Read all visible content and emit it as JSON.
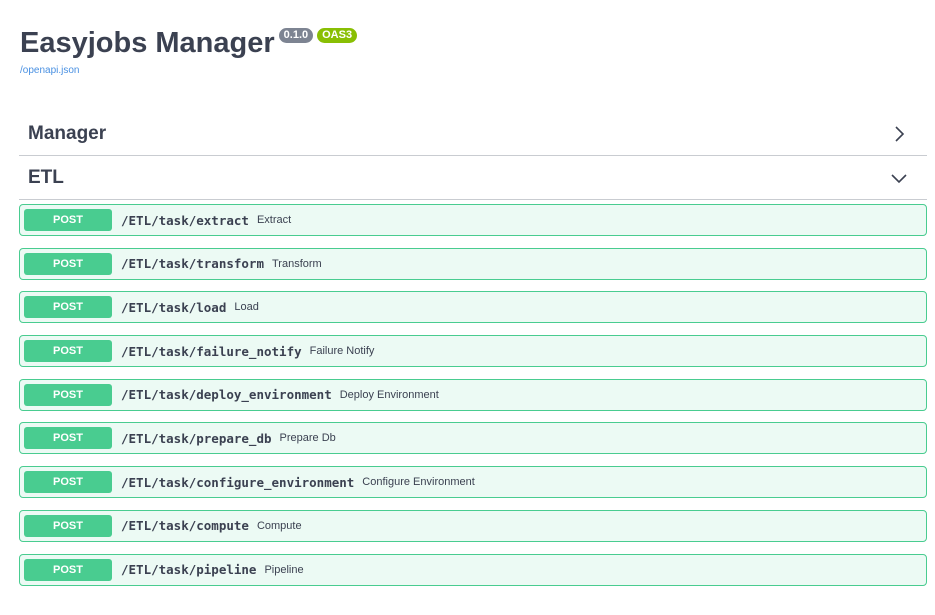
{
  "info": {
    "title": "Easyjobs Manager",
    "version_badge": "0.1.0",
    "oas_badge": "OAS3",
    "spec_link": "/openapi.json"
  },
  "tags": [
    {
      "name": "Manager",
      "expanded": false,
      "chevron_icon": "chevron-right-icon"
    },
    {
      "name": "ETL",
      "expanded": true,
      "chevron_icon": "chevron-down-icon"
    }
  ],
  "operations": [
    {
      "method": "POST",
      "path": "/ETL/task/extract",
      "summary": "Extract"
    },
    {
      "method": "POST",
      "path": "/ETL/task/transform",
      "summary": "Transform"
    },
    {
      "method": "POST",
      "path": "/ETL/task/load",
      "summary": "Load"
    },
    {
      "method": "POST",
      "path": "/ETL/task/failure_notify",
      "summary": "Failure Notify"
    },
    {
      "method": "POST",
      "path": "/ETL/task/deploy_environment",
      "summary": "Deploy Environment"
    },
    {
      "method": "POST",
      "path": "/ETL/task/prepare_db",
      "summary": "Prepare Db"
    },
    {
      "method": "POST",
      "path": "/ETL/task/configure_environment",
      "summary": "Configure Environment"
    },
    {
      "method": "POST",
      "path": "/ETL/task/compute",
      "summary": "Compute"
    },
    {
      "method": "POST",
      "path": "/ETL/task/pipeline",
      "summary": "Pipeline"
    }
  ],
  "colors": {
    "post": "#49cc90",
    "version_badge": "#7d8492",
    "oas_badge": "#89bf04",
    "link": "#4990e2",
    "text": "#3b4151"
  }
}
